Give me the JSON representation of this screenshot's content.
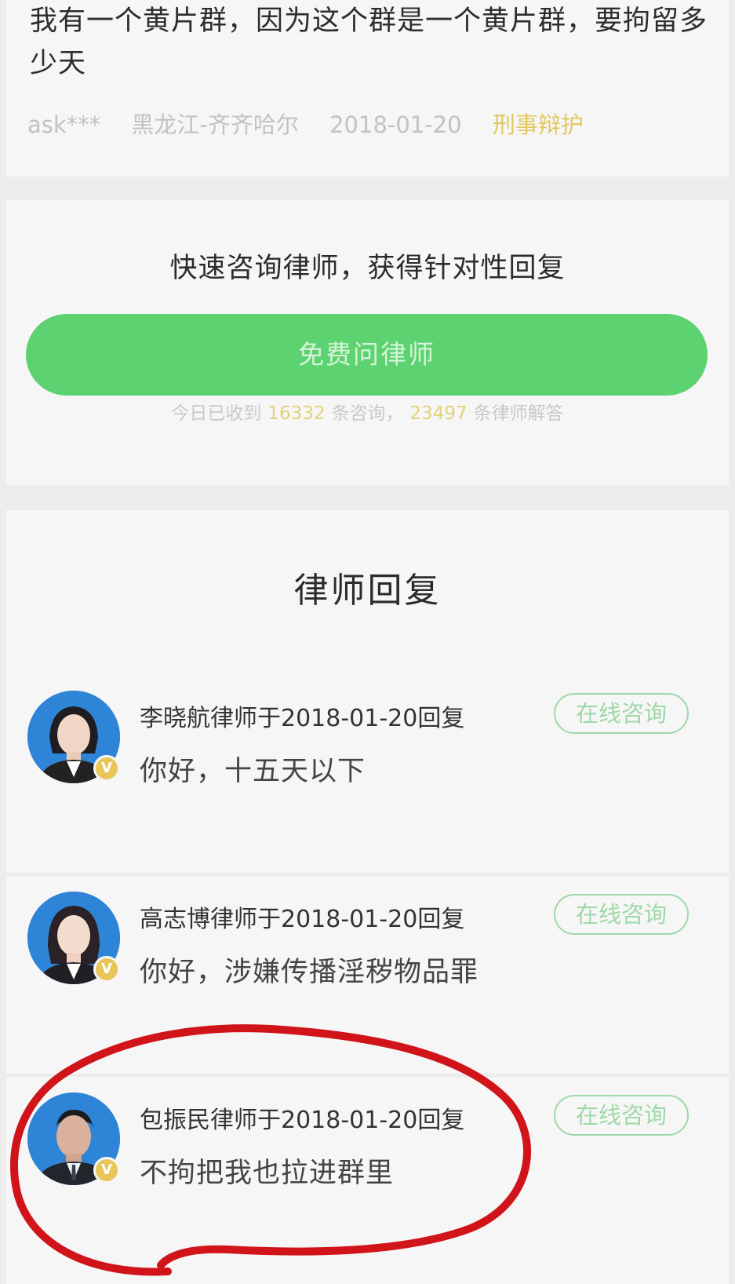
{
  "question": {
    "title": "我有一个黄片群，因为这个群是一个黄片群，要拘留多少天",
    "user": "ask***",
    "location": "黑龙江-齐齐哈尔",
    "date": "2018-01-20",
    "category": "刑事辩护"
  },
  "cta": {
    "title": "快速咨询律师，获得针对性回复",
    "button_label": "免费问律师",
    "stats_prefix": "今日已收到",
    "consult_count": "16332",
    "stats_middle": "条咨询，",
    "answer_count": "23497",
    "stats_suffix": "条律师解答"
  },
  "replies_section": {
    "title": "律师回复",
    "items": [
      {
        "header": "李晓航律师于2018-01-20回复",
        "body": "你好，十五天以下",
        "button_label": "在线咨询",
        "badge": "V"
      },
      {
        "header": "高志博律师于2018-01-20回复",
        "body": "你好，涉嫌传播淫秽物品罪",
        "button_label": "在线咨询",
        "badge": "V"
      },
      {
        "header": "包振民律师于2018-01-20回复",
        "body": "不拘把我也拉进群里",
        "button_label": "在线咨询",
        "badge": "V"
      }
    ]
  },
  "colors": {
    "accent_green": "#5dd270",
    "highlight_yellow": "#e2c860",
    "annotation_red": "#d0141a"
  }
}
